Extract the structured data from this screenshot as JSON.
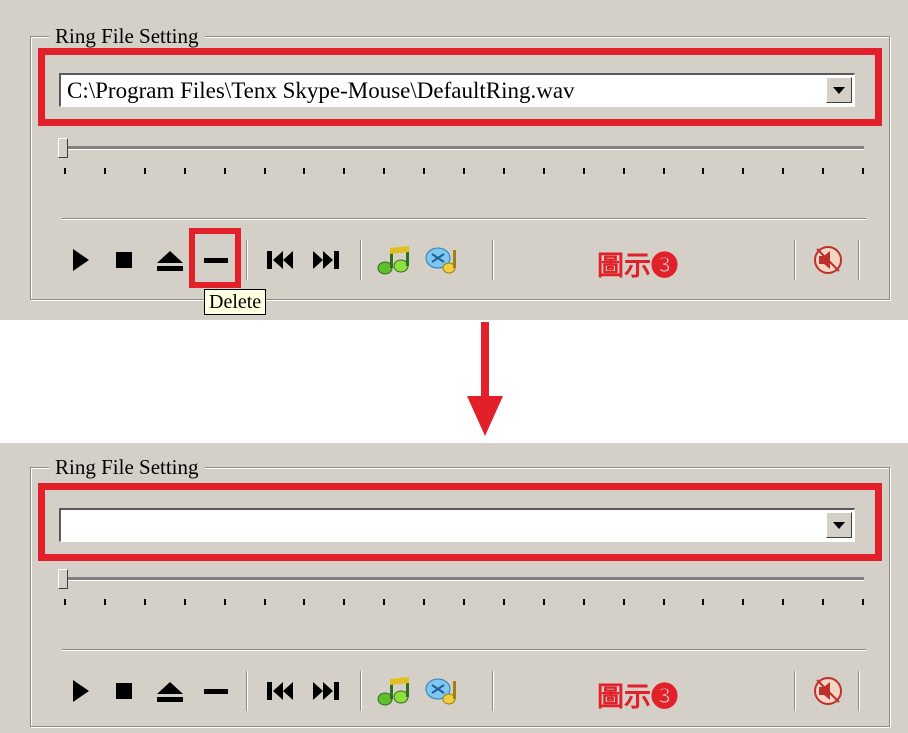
{
  "group_title": "Ring File Setting",
  "before": {
    "combo_value": "C:\\Program Files\\Tenx Skype-Mouse\\DefaultRing.wav",
    "caption": "圖示❸"
  },
  "after": {
    "combo_value": "",
    "caption": "圖示❸"
  },
  "tooltip": "Delete",
  "toolbar_icons": [
    "play-icon",
    "stop-icon",
    "eject-icon",
    "delete-icon",
    "previous-icon",
    "next-icon",
    "music-notes-green-icon",
    "music-notes-blue-icon",
    "speaker-icon"
  ],
  "colors": {
    "highlight": "#e1202a",
    "panel": "#d4d0c8",
    "caption": "#e1202a"
  }
}
